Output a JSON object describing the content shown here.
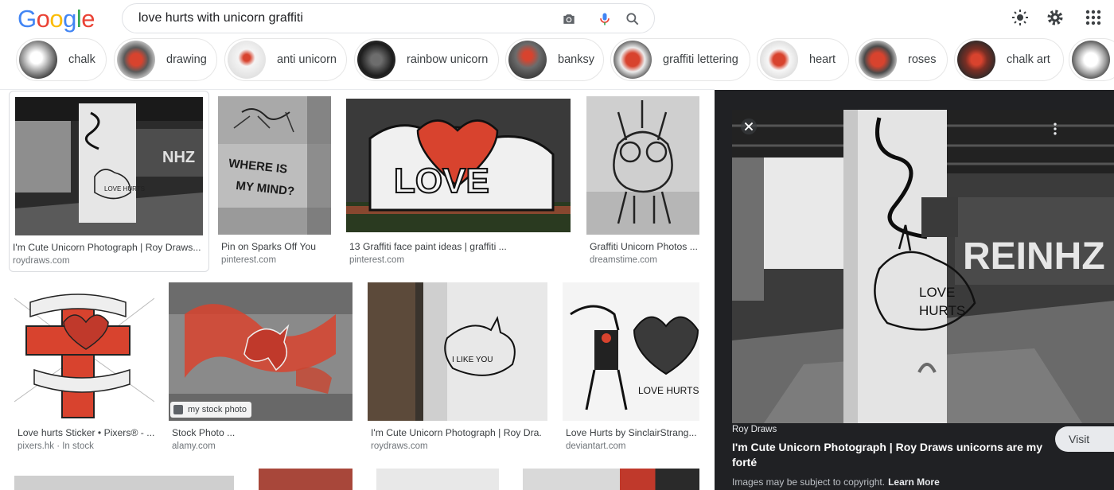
{
  "logo": {
    "text": "Google"
  },
  "search": {
    "query": "love hurts with unicorn graffiti"
  },
  "header_icons": [
    "brightness-icon",
    "settings-gear-icon",
    "apps-grid-icon"
  ],
  "chips": [
    {
      "label": "chalk"
    },
    {
      "label": "drawing"
    },
    {
      "label": "anti unicorn"
    },
    {
      "label": "rainbow unicorn"
    },
    {
      "label": "banksy"
    },
    {
      "label": "graffiti lettering"
    },
    {
      "label": "heart"
    },
    {
      "label": "roses"
    },
    {
      "label": "chalk art"
    }
  ],
  "results": [
    {
      "title": "I'm Cute Unicorn Photograph | Roy Draws...",
      "source": "roydraws.com",
      "badge": ""
    },
    {
      "title": "Pin on Sparks Off You",
      "source": "pinterest.com",
      "badge": ""
    },
    {
      "title": "13 Graffiti face paint ideas | graffiti ...",
      "source": "pinterest.com",
      "badge": ""
    },
    {
      "title": "Graffiti Unicorn Photos ...",
      "source": "dreamstime.com",
      "badge": ""
    },
    {
      "title": "Love hurts Sticker • Pixers® - ...",
      "source": "pixers.hk · In stock",
      "badge": ""
    },
    {
      "title": "Stock Photo ...",
      "source": "alamy.com",
      "badge": "my stock photo"
    },
    {
      "title": "I'm Cute Unicorn Photograph | Roy Dra...",
      "source": "roydraws.com",
      "badge": ""
    },
    {
      "title": "Love Hurts by SinclairStrang...",
      "source": "deviantart.com",
      "badge": ""
    }
  ],
  "thumb_text": {
    "where_is_my_mind": "WHERE IS MY MIND?",
    "love": "LOVE",
    "love_hurts": "LOVE HURTS",
    "i_like_you": "I LIKE YOU"
  },
  "preview": {
    "site": "Roy Draws",
    "title": "I'm Cute Unicorn Photograph | Roy Draws unicorns are my forté",
    "visit_label": "Visit",
    "copyright": "Images may be subject to copyright.",
    "learn_more": "Learn More"
  },
  "colors": {
    "google_blue": "#4285F4",
    "google_red": "#EA4335",
    "google_yellow": "#FBBC05",
    "google_green": "#34A853",
    "graffiti_red": "#d8432e",
    "preview_bg": "#202124"
  }
}
